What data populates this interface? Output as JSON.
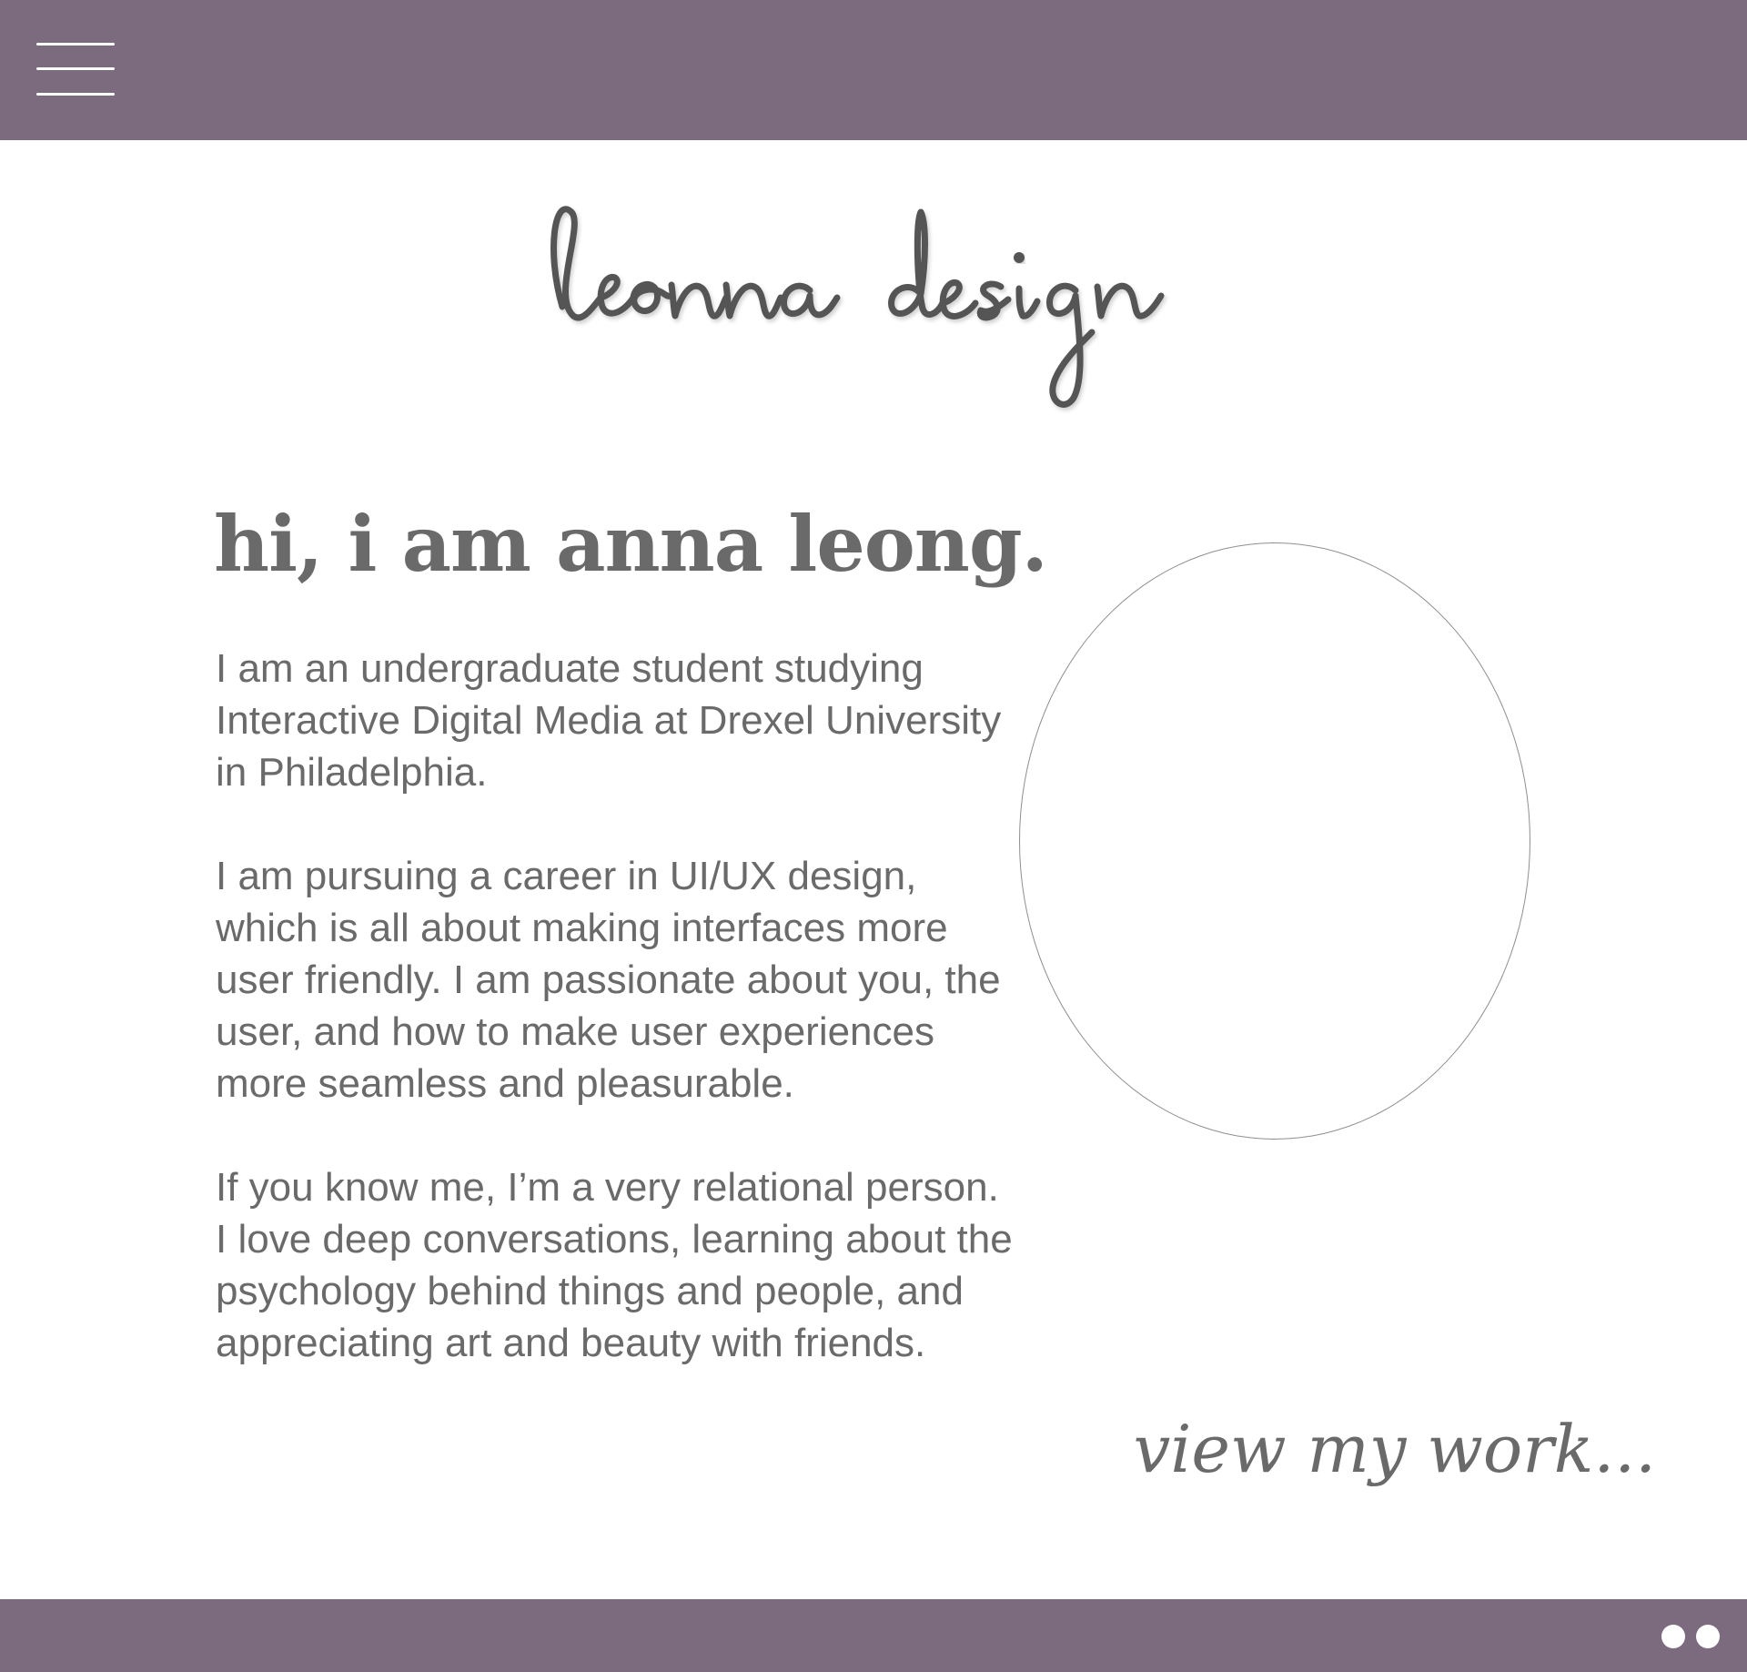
{
  "header": {
    "menu_icon": "hamburger-menu-icon"
  },
  "logo": {
    "text": "leonna design"
  },
  "intro": {
    "headline": "hi, i am anna leong.",
    "paragraphs": [
      "I am an undergraduate student studying Interactive Digital Media at Drexel University in Philadelphia.",
      "I am pursuing a career in UI/UX design, which is all about making interfaces more user friendly. I am passionate about you, the user, and how to make user experiences more seamless and pleasurable.",
      "If you know me, I’m a very relational person. I love deep conversations, learning about the psychology behind things and people, and appreciating art and beauty with friends."
    ]
  },
  "cta": {
    "label": "view my work..."
  },
  "footer": {
    "pagination_dots": 2
  },
  "colors": {
    "brand_bar": "#7c6a7f",
    "text_gray": "#6a6a6a",
    "background": "#ffffff"
  }
}
